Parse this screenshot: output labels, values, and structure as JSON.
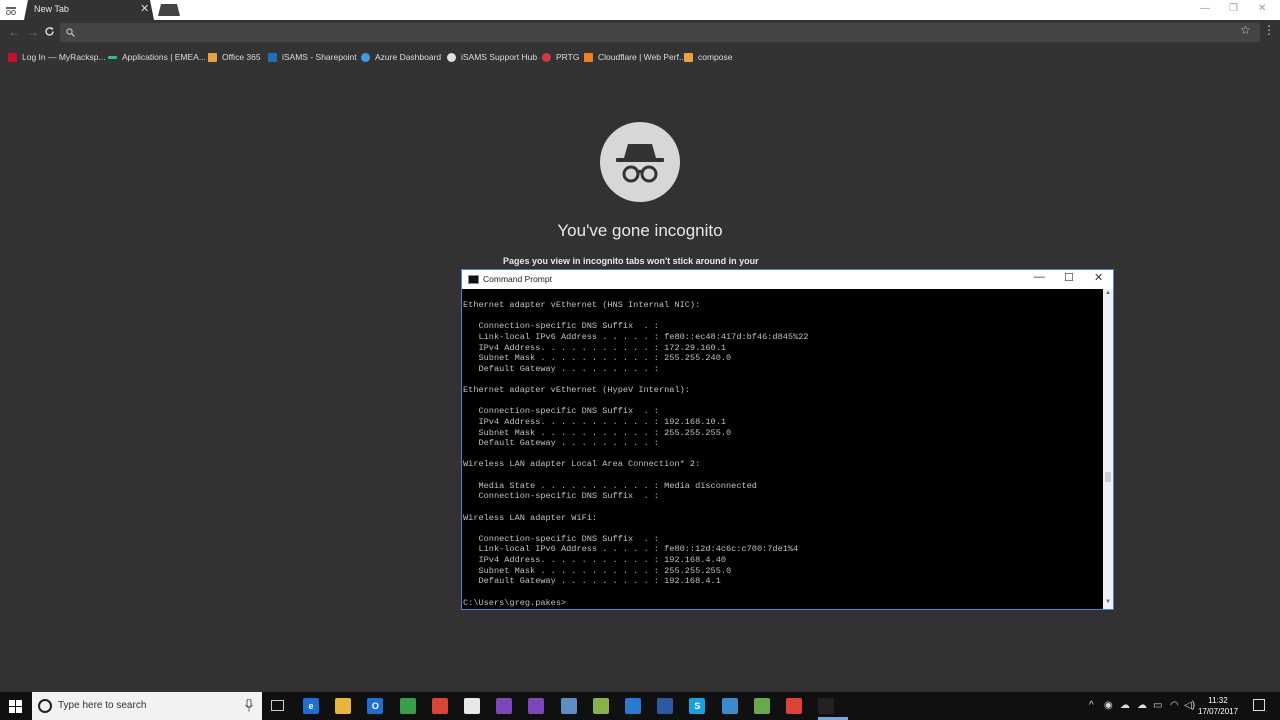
{
  "browser": {
    "tab_title": "New Tab",
    "tab_close": "✕",
    "nav": {
      "back": "←",
      "forward": "→",
      "reload": "C"
    }
  },
  "bookmarks": [
    {
      "label": "Log In — MyRacksp...",
      "icon": "rackspace-icon",
      "color": "#c8102e"
    },
    {
      "label": "Applications | EMEA...",
      "icon": "apps-icon",
      "color": "#2bbf8a"
    },
    {
      "label": "Office 365",
      "icon": "office365-icon",
      "color": "#e8a33a"
    },
    {
      "label": "iSAMS - Sharepoint",
      "icon": "sharepoint-icon",
      "color": "#1f6fb8"
    },
    {
      "label": "Azure Dashboard",
      "icon": "azure-icon",
      "color": "#3aa0e6"
    },
    {
      "label": "iSAMS Support Hub",
      "icon": "support-hub-icon",
      "color": "#e0e0e0"
    },
    {
      "label": "PRTG",
      "icon": "prtg-icon",
      "color": "#d23b3b"
    },
    {
      "label": "Cloudflare | Web Perf...",
      "icon": "cloudflare-icon",
      "color": "#f38020"
    },
    {
      "label": "compose",
      "icon": "compose-icon",
      "color": "#e8a33a"
    }
  ],
  "ntp": {
    "title": "You've gone incognito",
    "description": "Pages you view in incognito tabs won't stick around in your"
  },
  "cmd": {
    "title": "Command Prompt",
    "lines": [
      "Ethernet adapter vEthernet (HNS Internal NIC):",
      "",
      "   Connection-specific DNS Suffix  . :",
      "   Link-local IPv6 Address . . . . . : fe80::ec48:417d:bf46:d845%22",
      "   IPv4 Address. . . . . . . . . . . : 172.29.160.1",
      "   Subnet Mask . . . . . . . . . . . : 255.255.240.0",
      "   Default Gateway . . . . . . . . . :",
      "",
      "Ethernet adapter vEthernet (HypeV Internal):",
      "",
      "   Connection-specific DNS Suffix  . :",
      "   IPv4 Address. . . . . . . . . . . : 192.168.10.1",
      "   Subnet Mask . . . . . . . . . . . : 255.255.255.0",
      "   Default Gateway . . . . . . . . . :",
      "",
      "Wireless LAN adapter Local Area Connection* 2:",
      "",
      "   Media State . . . . . . . . . . . : Media disconnected",
      "   Connection-specific DNS Suffix  . :",
      "",
      "Wireless LAN adapter WiFi:",
      "",
      "   Connection-specific DNS Suffix  . :",
      "   Link-local IPv6 Address . . . . . : fe80::12d:4c6c:c700:7de1%4",
      "   IPv4 Address. . . . . . . . . . . : 192.168.4.40",
      "   Subnet Mask . . . . . . . . . . . : 255.255.255.0",
      "   Default Gateway . . . . . . . . . : 192.168.4.1",
      "",
      "C:\\Users\\greg.pakes>"
    ]
  },
  "taskbar": {
    "search_placeholder": "Type here to search",
    "apps": [
      {
        "name": "edge-icon",
        "color": "#1e6fd0",
        "glyph": "e"
      },
      {
        "name": "file-explorer-icon",
        "color": "#e8b53a",
        "glyph": ""
      },
      {
        "name": "outlook-icon",
        "color": "#1e6fd0",
        "glyph": "O"
      },
      {
        "name": "chrome-icon",
        "color": "#3a9f4a",
        "glyph": ""
      },
      {
        "name": "chrome-incognito-icon",
        "color": "#db4437",
        "glyph": ""
      },
      {
        "name": "store-icon",
        "color": "#e8e8e8",
        "glyph": ""
      },
      {
        "name": "visual-studio-icon",
        "color": "#7a48b8",
        "glyph": ""
      },
      {
        "name": "visual-studio-alt-icon",
        "color": "#7a48b8",
        "glyph": ""
      },
      {
        "name": "network-tool-icon",
        "color": "#5a8fc0",
        "glyph": ""
      },
      {
        "name": "tools-icon",
        "color": "#8ab04a",
        "glyph": ""
      },
      {
        "name": "vscode-icon",
        "color": "#2a7ad0",
        "glyph": ""
      },
      {
        "name": "powershell-icon",
        "color": "#2a5aa0",
        "glyph": ""
      },
      {
        "name": "skype-icon",
        "color": "#1aa0e0",
        "glyph": "S"
      },
      {
        "name": "remote-desktop-icon",
        "color": "#3a8ad0",
        "glyph": ""
      },
      {
        "name": "notepad-icon",
        "color": "#6aa84f",
        "glyph": ""
      },
      {
        "name": "chrome-app-icon",
        "color": "#db4437",
        "glyph": ""
      },
      {
        "name": "command-prompt-icon",
        "color": "#222222",
        "glyph": ""
      }
    ],
    "time": "11:32",
    "date": "17/07/2017"
  }
}
